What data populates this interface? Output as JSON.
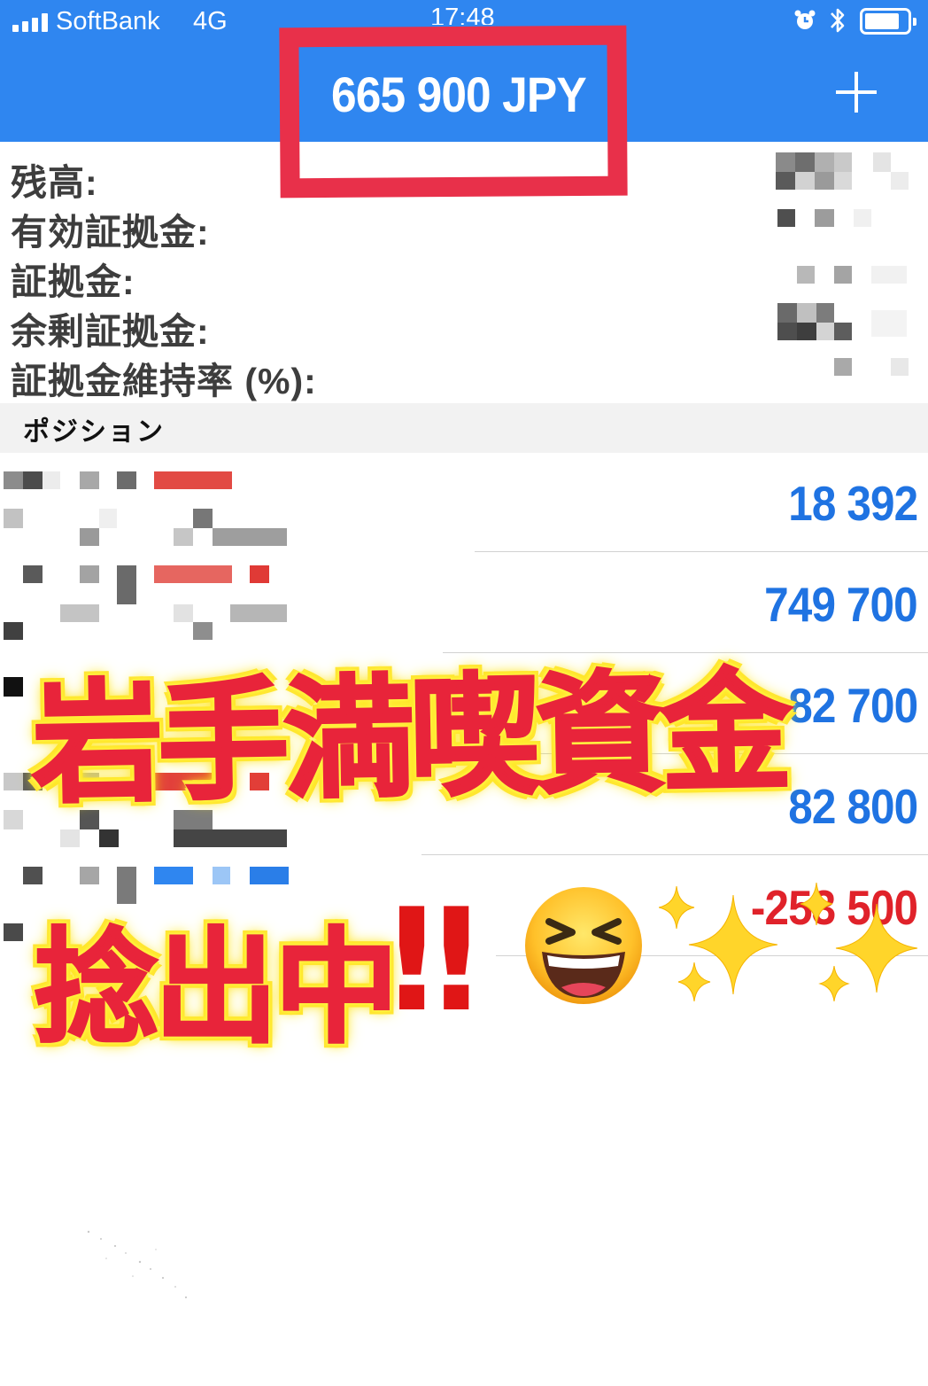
{
  "status_bar": {
    "carrier": "SoftBank",
    "network": "4G",
    "time": "17:48"
  },
  "header": {
    "balance_title": "665 900 JPY",
    "add_icon": "plus-icon",
    "colors": {
      "header_bg": "#2f86f0",
      "highlight": "#e8304a"
    }
  },
  "summary": {
    "balance_label": "残高:",
    "equity_label": "有効証拠金:",
    "margin_label": "証拠金:",
    "free_margin_label": "余剰証拠金:",
    "margin_level_label": "証拠金維持率 (%):"
  },
  "positions": {
    "section_title": "ポジション",
    "values": [
      "18 392",
      "749 700",
      "82 700",
      "82 800",
      "-253 500"
    ],
    "colors": {
      "profit": "#1f73e2",
      "loss": "#e0222a"
    }
  },
  "overlay": {
    "line1": "岩手満喫資金",
    "line2": "捻出中",
    "exclamation": "‼",
    "emoji": "laughing-face-icon",
    "sparkles": "sparkles-icon"
  }
}
